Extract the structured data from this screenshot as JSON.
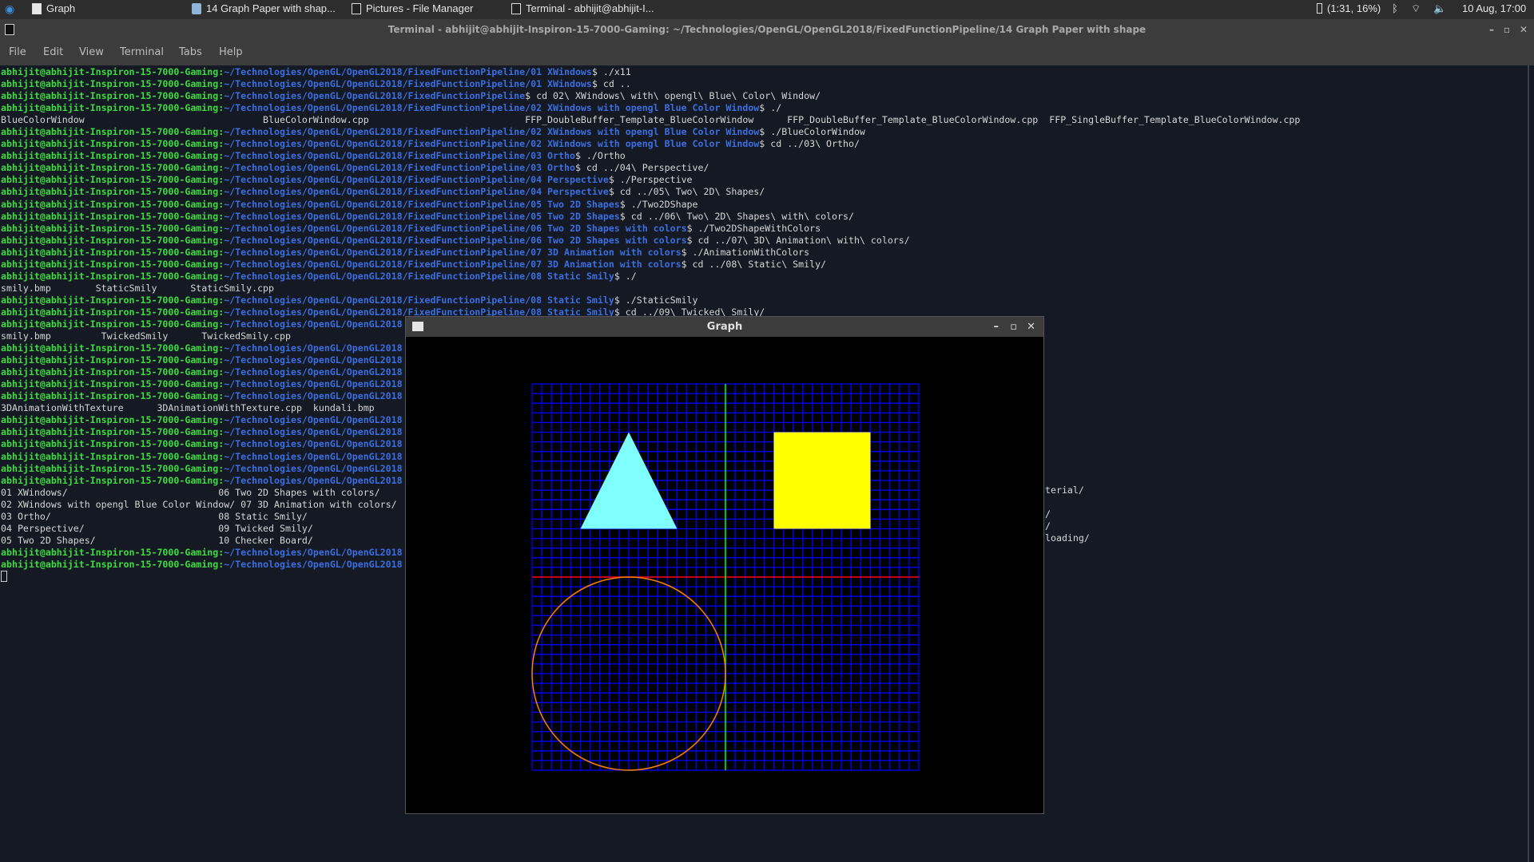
{
  "panel": {
    "tasks": [
      {
        "label": "Graph",
        "icon": "window-icon"
      },
      {
        "label": "14 Graph Paper with shap...",
        "icon": "folder-icon"
      },
      {
        "label": "Pictures - File Manager",
        "icon": "file-manager-icon"
      },
      {
        "label": "Terminal - abhijit@abhijit-I...",
        "icon": "terminal-icon"
      }
    ],
    "battery": "(1:31, 16%)",
    "clock": "10 Aug, 17:00"
  },
  "terminal": {
    "title": "Terminal - abhijit@abhijit-Inspiron-15-7000-Gaming: ~/Technologies/OpenGL/OpenGL2018/FixedFunctionPipeline/14 Graph Paper with shape",
    "menu": [
      "File",
      "Edit",
      "View",
      "Terminal",
      "Tabs",
      "Help"
    ],
    "lines": [
      [
        "abhijit@abhijit-Inspiron-15-7000-Gaming:",
        "~/Technologies/OpenGL/OpenGL2018/FixedFunctionPipeline/01 XWindows",
        "$ ./x11"
      ],
      [
        "abhijit@abhijit-Inspiron-15-7000-Gaming:",
        "~/Technologies/OpenGL/OpenGL2018/FixedFunctionPipeline/01 XWindows",
        "$ cd .."
      ],
      [
        "abhijit@abhijit-Inspiron-15-7000-Gaming:",
        "~/Technologies/OpenGL/OpenGL2018/FixedFunctionPipeline",
        "$ cd 02\\ XWindows\\ with\\ opengl\\ Blue\\ Color\\ Window/"
      ],
      [
        "abhijit@abhijit-Inspiron-15-7000-Gaming:",
        "~/Technologies/OpenGL/OpenGL2018/FixedFunctionPipeline/02 XWindows with opengl Blue Color Window",
        "$ ./"
      ],
      [
        "",
        "",
        "BlueColorWindow                                BlueColorWindow.cpp                            FFP_DoubleBuffer_Template_BlueColorWindow      FFP_DoubleBuffer_Template_BlueColorWindow.cpp  FFP_SingleBuffer_Template_BlueColorWindow.cpp"
      ],
      [
        "abhijit@abhijit-Inspiron-15-7000-Gaming:",
        "~/Technologies/OpenGL/OpenGL2018/FixedFunctionPipeline/02 XWindows with opengl Blue Color Window",
        "$ ./BlueColorWindow"
      ],
      [
        "abhijit@abhijit-Inspiron-15-7000-Gaming:",
        "~/Technologies/OpenGL/OpenGL2018/FixedFunctionPipeline/02 XWindows with opengl Blue Color Window",
        "$ cd ../03\\ Ortho/"
      ],
      [
        "abhijit@abhijit-Inspiron-15-7000-Gaming:",
        "~/Technologies/OpenGL/OpenGL2018/FixedFunctionPipeline/03 Ortho",
        "$ ./Ortho"
      ],
      [
        "abhijit@abhijit-Inspiron-15-7000-Gaming:",
        "~/Technologies/OpenGL/OpenGL2018/FixedFunctionPipeline/03 Ortho",
        "$ cd ../04\\ Perspective/"
      ],
      [
        "abhijit@abhijit-Inspiron-15-7000-Gaming:",
        "~/Technologies/OpenGL/OpenGL2018/FixedFunctionPipeline/04 Perspective",
        "$ ./Perspective"
      ],
      [
        "abhijit@abhijit-Inspiron-15-7000-Gaming:",
        "~/Technologies/OpenGL/OpenGL2018/FixedFunctionPipeline/04 Perspective",
        "$ cd ../05\\ Two\\ 2D\\ Shapes/"
      ],
      [
        "abhijit@abhijit-Inspiron-15-7000-Gaming:",
        "~/Technologies/OpenGL/OpenGL2018/FixedFunctionPipeline/05 Two 2D Shapes",
        "$ ./Two2DShape"
      ],
      [
        "abhijit@abhijit-Inspiron-15-7000-Gaming:",
        "~/Technologies/OpenGL/OpenGL2018/FixedFunctionPipeline/05 Two 2D Shapes",
        "$ cd ../06\\ Two\\ 2D\\ Shapes\\ with\\ colors/"
      ],
      [
        "abhijit@abhijit-Inspiron-15-7000-Gaming:",
        "~/Technologies/OpenGL/OpenGL2018/FixedFunctionPipeline/06 Two 2D Shapes with colors",
        "$ ./Two2DShapeWithColors"
      ],
      [
        "abhijit@abhijit-Inspiron-15-7000-Gaming:",
        "~/Technologies/OpenGL/OpenGL2018/FixedFunctionPipeline/06 Two 2D Shapes with colors",
        "$ cd ../07\\ 3D\\ Animation\\ with\\ colors/"
      ],
      [
        "abhijit@abhijit-Inspiron-15-7000-Gaming:",
        "~/Technologies/OpenGL/OpenGL2018/FixedFunctionPipeline/07 3D Animation with colors",
        "$ ./AnimationWithColors"
      ],
      [
        "abhijit@abhijit-Inspiron-15-7000-Gaming:",
        "~/Technologies/OpenGL/OpenGL2018/FixedFunctionPipeline/07 3D Animation with colors",
        "$ cd ../08\\ Static\\ Smily/"
      ],
      [
        "abhijit@abhijit-Inspiron-15-7000-Gaming:",
        "~/Technologies/OpenGL/OpenGL2018/FixedFunctionPipeline/08 Static Smily",
        "$ ./"
      ],
      [
        "",
        "",
        "smily.bmp        StaticSmily      StaticSmily.cpp"
      ],
      [
        "abhijit@abhijit-Inspiron-15-7000-Gaming:",
        "~/Technologies/OpenGL/OpenGL2018/FixedFunctionPipeline/08 Static Smily",
        "$ ./StaticSmily"
      ],
      [
        "abhijit@abhijit-Inspiron-15-7000-Gaming:",
        "~/Technologies/OpenGL/OpenGL2018/FixedFunctionPipeline/08 Static Smily",
        "$ cd ../09\\ Twicked\\ Smily/"
      ],
      [
        "abhijit@abhijit-Inspiron-15-7000-Gaming:",
        "~/Technologies/OpenGL/OpenGL2018",
        ""
      ],
      [
        "",
        "",
        "smily.bmp         TwickedSmily      TwickedSmily.cpp"
      ],
      [
        "abhijit@abhijit-Inspiron-15-7000-Gaming:",
        "~/Technologies/OpenGL/OpenGL2018",
        ""
      ],
      [
        "abhijit@abhijit-Inspiron-15-7000-Gaming:",
        "~/Technologies/OpenGL/OpenGL2018",
        ""
      ],
      [
        "abhijit@abhijit-Inspiron-15-7000-Gaming:",
        "~/Technologies/OpenGL/OpenGL2018",
        ""
      ],
      [
        "abhijit@abhijit-Inspiron-15-7000-Gaming:",
        "~/Technologies/OpenGL/OpenGL2018",
        ""
      ],
      [
        "abhijit@abhijit-Inspiron-15-7000-Gaming:",
        "~/Technologies/OpenGL/OpenGL2018",
        ""
      ],
      [
        "",
        "",
        "3DAnimationWithTexture      3DAnimationWithTexture.cpp  kundali.bmp"
      ],
      [
        "abhijit@abhijit-Inspiron-15-7000-Gaming:",
        "~/Technologies/OpenGL/OpenGL2018",
        ""
      ],
      [
        "abhijit@abhijit-Inspiron-15-7000-Gaming:",
        "~/Technologies/OpenGL/OpenGL2018",
        ""
      ],
      [
        "abhijit@abhijit-Inspiron-15-7000-Gaming:",
        "~/Technologies/OpenGL/OpenGL2018",
        ""
      ],
      [
        "abhijit@abhijit-Inspiron-15-7000-Gaming:",
        "~/Technologies/OpenGL/OpenGL2018",
        ""
      ],
      [
        "abhijit@abhijit-Inspiron-15-7000-Gaming:",
        "~/Technologies/OpenGL/OpenGL2018",
        ""
      ],
      [
        "abhijit@abhijit-Inspiron-15-7000-Gaming:",
        "~/Technologies/OpenGL/OpenGL2018",
        ""
      ],
      [
        "",
        "",
        "01 XWindows/                           06 Two 2D Shapes with colors/"
      ],
      [
        "",
        "",
        "02 XWindows with opengl Blue Color Window/ 07 3D Animation with colors/"
      ],
      [
        "",
        "",
        "03 Ortho/                              08 Static Smily/"
      ],
      [
        "",
        "",
        "04 Perspective/                        09 Twicked Smily/"
      ],
      [
        "",
        "",
        "05 Two 2D Shapes/                      10 Checker Board/"
      ],
      [
        "abhijit@abhijit-Inspiron-15-7000-Gaming:",
        "~/Technologies/OpenGL/OpenGL2018",
        ""
      ],
      [
        "abhijit@abhijit-Inspiron-15-7000-Gaming:",
        "~/Technologies/OpenGL/OpenGL2018",
        ""
      ]
    ],
    "fragments": [
      "terial/",
      "/",
      "/",
      "loading/"
    ]
  },
  "graph": {
    "title": "Graph",
    "range": [
      -1,
      1
    ],
    "grid_step": 0.05,
    "colors": {
      "grid": "#0000ff",
      "x_axis": "#ff0000",
      "y_axis": "#00ff00",
      "triangle": "#80ffff",
      "square": "#ffff00",
      "circle": "#ff8000"
    },
    "triangle": [
      [
        -0.5,
        0.75
      ],
      [
        -0.75,
        0.25
      ],
      [
        -0.25,
        0.25
      ]
    ],
    "square": [
      [
        0.25,
        0.75
      ],
      [
        0.75,
        0.75
      ],
      [
        0.75,
        0.25
      ],
      [
        0.25,
        0.25
      ]
    ],
    "circle": {
      "center": [
        -0.5,
        -0.5
      ],
      "radius": 0.5
    }
  }
}
